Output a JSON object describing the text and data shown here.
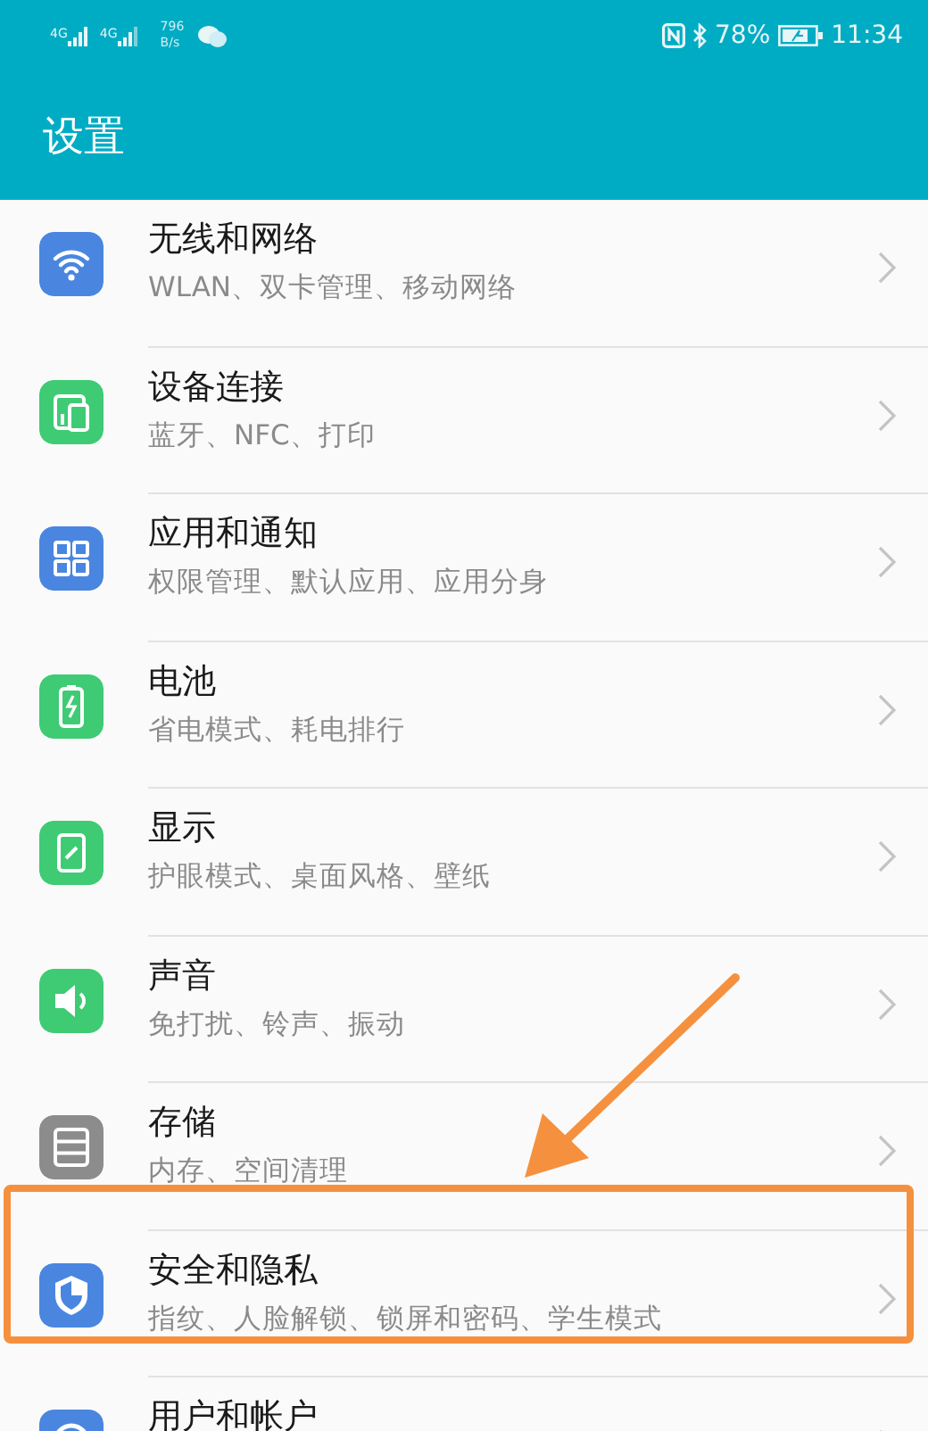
{
  "status_bar": {
    "sim_labels": [
      "4G",
      "4G"
    ],
    "speed_value": "796",
    "speed_unit": "B/s",
    "battery": "78%",
    "time": "11:34"
  },
  "header": {
    "title": "设置"
  },
  "items": [
    {
      "title": "无线和网络",
      "subtitle": "WLAN、双卡管理、移动网络",
      "color": "#4a86e0",
      "highlighted": false
    },
    {
      "title": "设备连接",
      "subtitle": "蓝牙、NFC、打印",
      "color": "#3fcb74",
      "highlighted": false
    },
    {
      "title": "应用和通知",
      "subtitle": "权限管理、默认应用、应用分身",
      "color": "#4a86e0",
      "highlighted": false
    },
    {
      "title": "电池",
      "subtitle": "省电模式、耗电排行",
      "color": "#3fcb74",
      "highlighted": false
    },
    {
      "title": "显示",
      "subtitle": "护眼模式、桌面风格、壁纸",
      "color": "#3fcb74",
      "highlighted": false
    },
    {
      "title": "声音",
      "subtitle": "免打扰、铃声、振动",
      "color": "#3fcb74",
      "highlighted": false
    },
    {
      "title": "存储",
      "subtitle": "内存、空间清理",
      "color": "#8c8c8c",
      "highlighted": false
    },
    {
      "title": "安全和隐私",
      "subtitle": "指纹、人脸解锁、锁屏和密码、学生模式",
      "color": "#4a86e0",
      "highlighted": true
    },
    {
      "title": "用户和帐户",
      "color": "#4a86e0",
      "highlighted": false
    }
  ]
}
